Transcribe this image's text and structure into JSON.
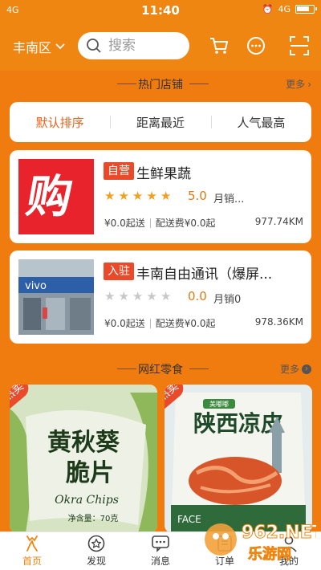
{
  "status": {
    "left": "4G",
    "time": "11:40",
    "right": "4G"
  },
  "header": {
    "location": "丰南区",
    "search_placeholder": "搜索"
  },
  "hot_shops": {
    "title": "热门店铺",
    "more": "更多"
  },
  "sort_tabs": [
    {
      "label": "默认排序",
      "active": true
    },
    {
      "label": "距离最近",
      "active": false
    },
    {
      "label": "人气最高",
      "active": false
    }
  ],
  "shops": [
    {
      "tag": "自营",
      "name": "生鲜果蔬",
      "rating": "5.0",
      "rating_value": 5,
      "sales": "月销...",
      "min_order": "¥0.0起送",
      "delivery": "配送费¥0.0起",
      "distance": "977.74KM",
      "logo_text": "购"
    },
    {
      "tag": "入驻",
      "name": "丰南自由通讯（爆屏...",
      "rating": "0.0",
      "rating_value": 0,
      "sales": "月销0",
      "min_order": "¥0.0起送",
      "delivery": "配送费¥0.0起",
      "distance": "978.36KM",
      "logo_text": "vivo"
    }
  ],
  "snacks": {
    "title": "网红零食",
    "more": "更多",
    "items": [
      {
        "badge": "热卖",
        "line1": "黄秋葵",
        "line2": "脆片",
        "sub": "Okra Chips",
        "weight": "净含量：70克"
      },
      {
        "badge": "热卖",
        "brand": "美嘟嘟",
        "line1": "陕西凉皮",
        "sub": "FACE"
      }
    ]
  },
  "tabbar": [
    {
      "label": "首页",
      "icon": "deer-icon",
      "active": true
    },
    {
      "label": "发现",
      "icon": "star-circle-icon",
      "active": false
    },
    {
      "label": "消息",
      "icon": "chat-icon",
      "active": false
    },
    {
      "label": "订单",
      "icon": "order-icon",
      "active": false
    },
    {
      "label": "我的",
      "icon": "user-icon",
      "active": false
    }
  ],
  "watermark": {
    "line1": "962.NET",
    "line2": "乐游网"
  },
  "colors": {
    "accent": "#f08612",
    "tag": "#e84a2a",
    "star": "#f0a020"
  }
}
